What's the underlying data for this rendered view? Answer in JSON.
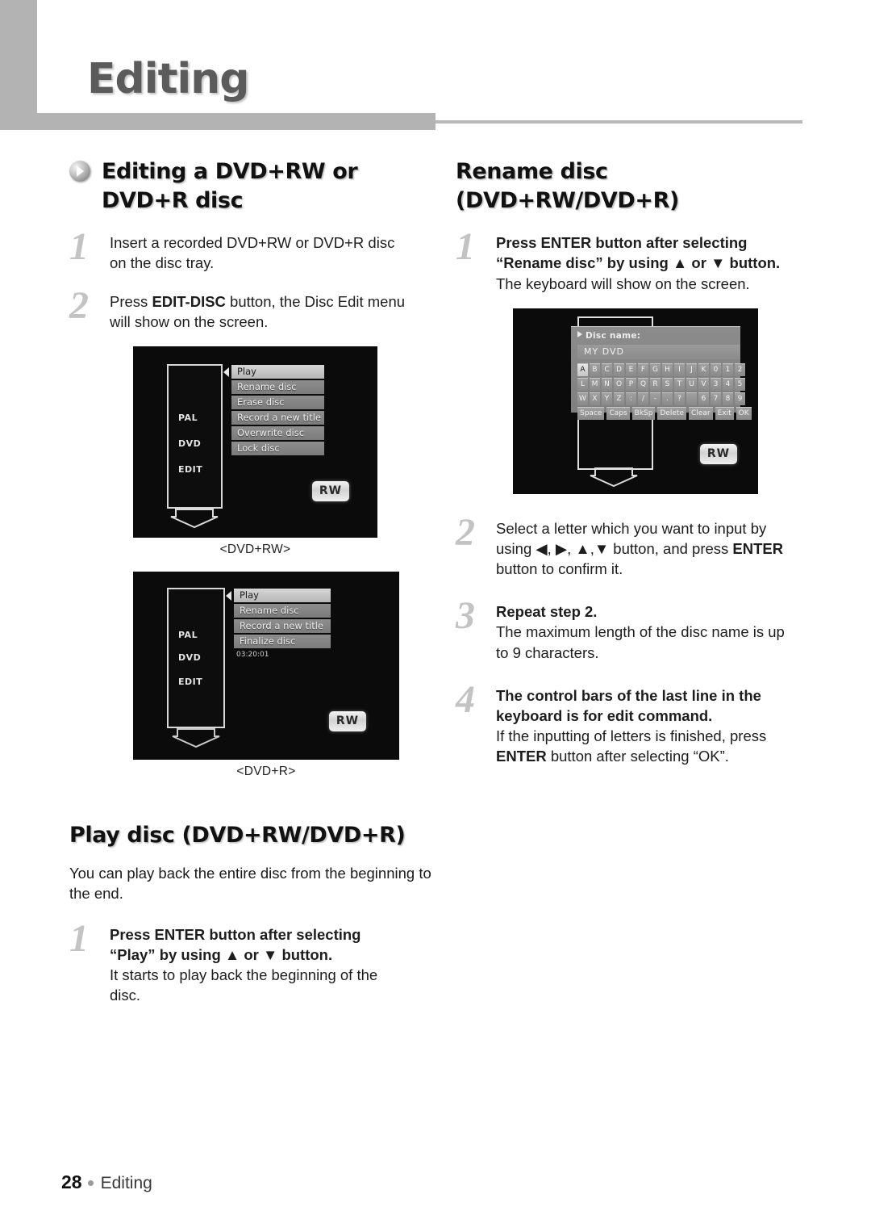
{
  "header": {
    "title": "Editing"
  },
  "left_column": {
    "section1": {
      "heading_line1": "Editing a DVD+RW or",
      "heading_line2": "DVD+R disc",
      "bullet_icon": "play-disc-icon",
      "steps": [
        {
          "number": "1",
          "lines": [
            "Insert a recorded DVD+RW or DVD+R disc",
            "on the disc tray."
          ]
        },
        {
          "number": "2",
          "line_prefix": "Press ",
          "line_bold": "EDIT-DISC",
          "line_suffix": " button, the Disc Edit menu",
          "line2": "will show on the screen."
        }
      ],
      "figure1": {
        "caption": "<DVD+RW>",
        "side_labels": [
          "PAL",
          "DVD",
          "EDIT"
        ],
        "menu_items": [
          "Play",
          "Rename disc",
          "Erase disc",
          "Record a new title",
          "Overwrite disc",
          "Lock disc"
        ],
        "selected_item": "Play",
        "badge": "RW"
      },
      "figure2": {
        "caption": "<DVD+R>",
        "side_labels": [
          "PAL",
          "DVD",
          "EDIT"
        ],
        "menu_items": [
          "Play",
          "Rename disc",
          "Record a new title",
          "Finalize disc"
        ],
        "selected_item": "Play",
        "sub_text": "03:20:01",
        "badge": "RW"
      }
    },
    "section2": {
      "heading": "Play disc (DVD+RW/DVD+R)",
      "intro": [
        "You can play back the entire disc from the",
        "beginning to the end."
      ],
      "steps": [
        {
          "number": "1",
          "bold_line1": "Press ENTER button after selecting",
          "bold_line2_a": "“Play” by using ",
          "bold_up": "▲",
          "bold_line2_b": " or ",
          "bold_down": "▼",
          "bold_line2_c": " button.",
          "plain_line1": "It starts to play back the beginning of the",
          "plain_line2": "disc."
        }
      ]
    }
  },
  "right_column": {
    "section1": {
      "heading": "Rename disc (DVD+RW/DVD+R)",
      "steps": [
        {
          "number": "1",
          "bold_line1": "Press ENTER button after selecting",
          "bold_line2_a": "“Rename disc” by using ",
          "bold_up": "▲",
          "bold_line2_b": " or ",
          "bold_down": "▼",
          "bold_line2_c": " button.",
          "plain_line1": "The keyboard will show on the screen."
        },
        {
          "number": "2",
          "line1": "Select a letter which you want to input by",
          "line2_a": "using ",
          "arrow_left": "◀",
          "arrow_right": "▶",
          "arrow_up": "▲",
          "arrow_down": "▼",
          "line2_b": " button, and press ",
          "line2_bold": "ENTER",
          "line3": "button to confirm it."
        },
        {
          "number": "3",
          "bold_line1": "Repeat step 2.",
          "plain_line1": "The maximum length of the disc name is up",
          "plain_line2": "to 9 characters."
        },
        {
          "number": "4",
          "bold_line1": "The control bars of the last line in the",
          "bold_line2": "keyboard is for edit command.",
          "plain_line1": "If the inputting of letters is finished, press",
          "plain_line2_bold": "ENTER",
          "plain_line2_rest": " button after selecting “OK”."
        }
      ],
      "figure": {
        "title": "Disc name:",
        "disc_name_value": "MY DVD",
        "key_rows": [
          [
            "A",
            "B",
            "C",
            "D",
            "E",
            "F",
            "G",
            "H",
            "I",
            "J",
            "K",
            "0",
            "1",
            "2"
          ],
          [
            "L",
            "M",
            "N",
            "O",
            "P",
            "Q",
            "R",
            "S",
            "T",
            "U",
            "V",
            "3",
            "4",
            "5"
          ],
          [
            "W",
            "X",
            "Y",
            "Z",
            ":",
            "/",
            "-",
            ".",
            "?",
            " ",
            "6",
            "7",
            "8",
            "9"
          ]
        ],
        "selected_key": "A",
        "command_keys": [
          "Space",
          "Caps",
          "BkSp",
          "Delete",
          "Clear",
          "Exit",
          "OK"
        ],
        "badge": "RW"
      }
    }
  },
  "footer": {
    "page_number": "28",
    "label": "Editing"
  },
  "colors": {
    "header_gray": "#b3b3b3",
    "step_number_gray": "#c3c3c3",
    "heading_blob_gray": "#c6c6c6",
    "title_gray": "#5b5b5b"
  }
}
